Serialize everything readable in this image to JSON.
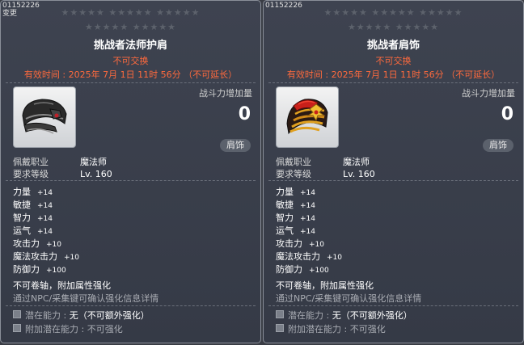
{
  "cards": [
    {
      "id_line": "01152226",
      "id_line2": "变更",
      "stars_row1": "★★★★★  ★★★★★  ★★★★★",
      "stars_row2": "★★★★★  ★★★★★",
      "title": "挑战者法师护肩",
      "untradable": "不可交换",
      "expiry": "有效时间 :  2025年  7月  1日  11时  56分 （不可延长）",
      "item_icon": "wizard-shoulder-icon",
      "power_label": "战斗力增加量",
      "power_value": "0",
      "slot": "肩饰",
      "req": [
        {
          "k": "佩戴职业",
          "v": "魔法师"
        },
        {
          "k": "要求等级",
          "v": "Lv. 160"
        }
      ],
      "stats": [
        {
          "k": "力量",
          "v": "+14"
        },
        {
          "k": "敏捷",
          "v": "+14"
        },
        {
          "k": "智力",
          "v": "+14"
        },
        {
          "k": "运气",
          "v": "+14"
        },
        {
          "k": "攻击力",
          "v": "+10"
        },
        {
          "k": "魔法攻击力",
          "v": "+10"
        },
        {
          "k": "防御力",
          "v": "+100"
        }
      ],
      "note1": "不可卷轴，附加属性强化",
      "note2": "通过NPC/采集键可确认强化信息详情",
      "potential_label": "潜在能力 :",
      "potential_value": "无（不可额外强化）",
      "bonus_potential_label": "附加潜在能力 :",
      "bonus_potential_value": "不可强化"
    },
    {
      "id_line": "01152226",
      "id_line2": "",
      "stars_row1": "★★★★★  ★★★★★  ★★★★★",
      "stars_row2": "★★★★★  ★★★★★",
      "title": "挑战者肩饰",
      "untradable": "不可交换",
      "expiry": "有效时间 :  2025年  7月  1日  11时  56分 （不可延长）",
      "item_icon": "challenger-shoulder-icon",
      "power_label": "战斗力增加量",
      "power_value": "0",
      "slot": "肩饰",
      "req": [
        {
          "k": "佩戴职业",
          "v": "魔法师"
        },
        {
          "k": "要求等级",
          "v": "Lv. 160"
        }
      ],
      "stats": [
        {
          "k": "力量",
          "v": "+14"
        },
        {
          "k": "敏捷",
          "v": "+14"
        },
        {
          "k": "智力",
          "v": "+14"
        },
        {
          "k": "运气",
          "v": "+14"
        },
        {
          "k": "攻击力",
          "v": "+10"
        },
        {
          "k": "魔法攻击力",
          "v": "+10"
        },
        {
          "k": "防御力",
          "v": "+100"
        }
      ],
      "note1": "不可卷轴，附加属性强化",
      "note2": "通过NPC/采集键可确认强化信息详情",
      "potential_label": "潜在能力 :",
      "potential_value": "无（不可额外强化）",
      "bonus_potential_label": "附加潜在能力 :",
      "bonus_potential_value": "不可强化"
    }
  ]
}
